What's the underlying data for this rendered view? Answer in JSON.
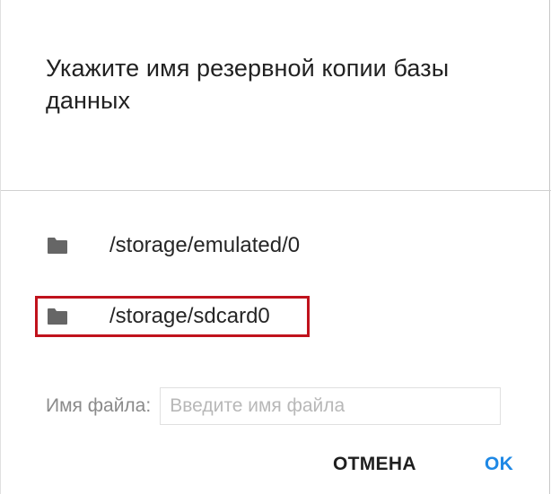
{
  "dialog": {
    "title": "Укажите имя резервной копии базы данных",
    "directories": [
      {
        "path": "/storage/emulated/0",
        "icon": "folder-icon"
      },
      {
        "path": "/storage/sdcard0",
        "icon": "folder-icon",
        "highlighted": true
      }
    ],
    "filename": {
      "label": "Имя файла:",
      "placeholder": "Введите имя файла",
      "value": ""
    },
    "buttons": {
      "cancel": "ОТМЕНА",
      "ok": "OK"
    }
  },
  "colors": {
    "accent": "#1e88e5",
    "highlight_border": "#c0121c",
    "folder": "#666666"
  }
}
